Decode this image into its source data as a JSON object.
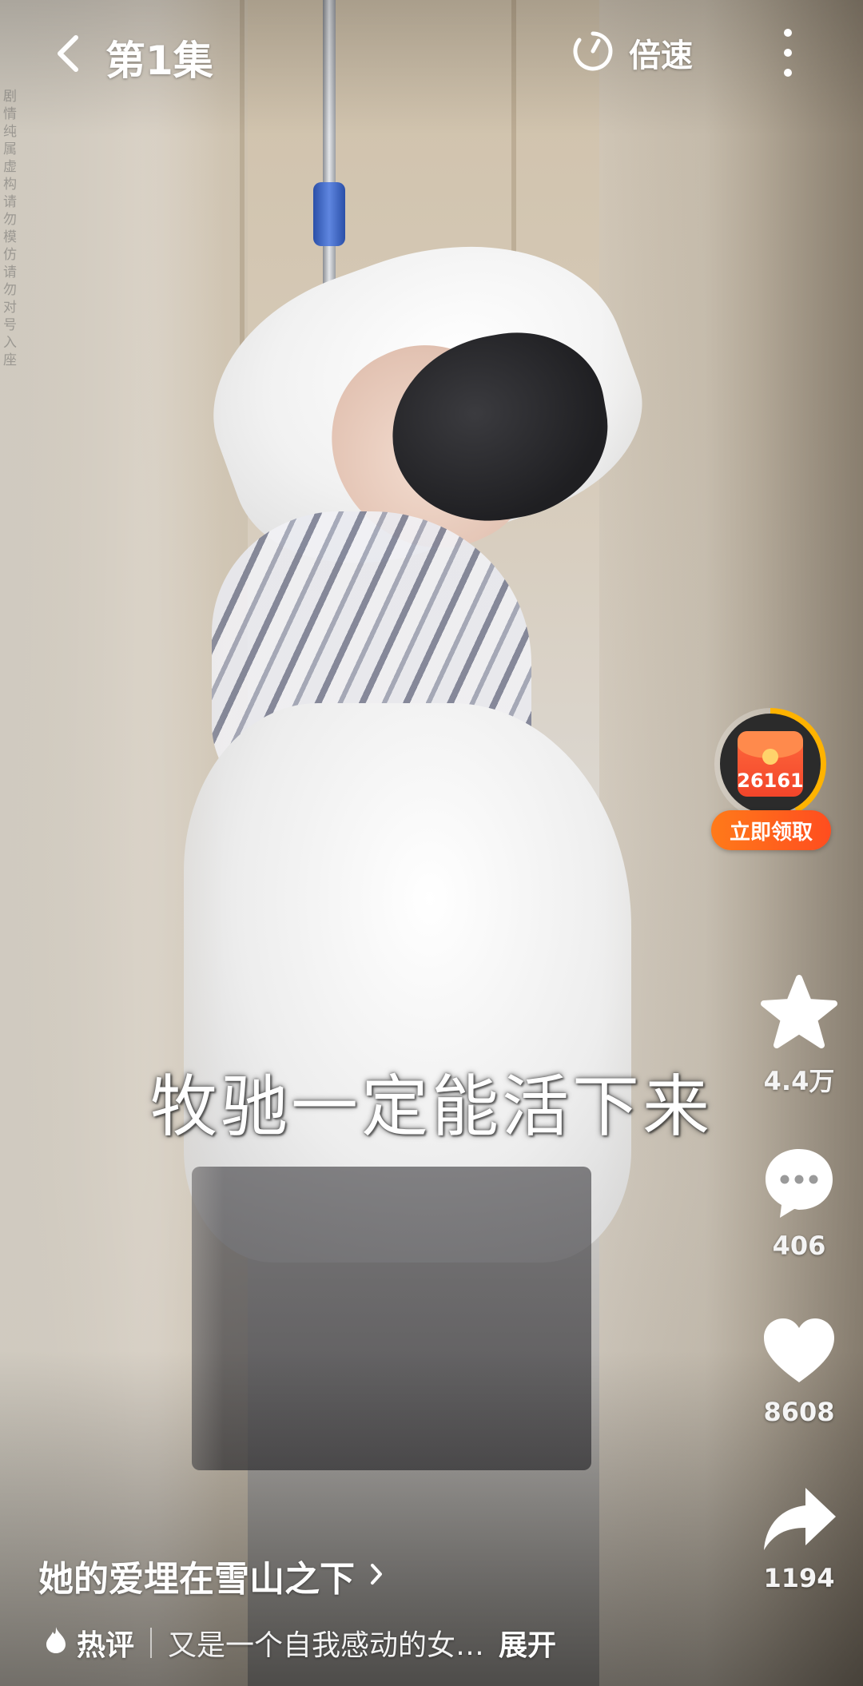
{
  "header": {
    "episode_title": "第1集",
    "speed_label": "倍速"
  },
  "video": {
    "subtitle": "牧驰一定能活下来",
    "watermark": "剧情纯属虚构请勿模仿请勿对号入座"
  },
  "reward": {
    "count": "26161",
    "claim_label": "立即领取",
    "progress": 0.42
  },
  "actions": {
    "favorite": {
      "icon": "star-icon",
      "count": "4.4万"
    },
    "comment": {
      "icon": "comment-icon",
      "count": "406"
    },
    "like": {
      "icon": "heart-icon",
      "count": "8608"
    },
    "share": {
      "icon": "share-icon",
      "count": "1194"
    }
  },
  "info": {
    "drama_title": "她的爱埋在雪山之下",
    "hot_label": "热评",
    "hot_comment": "又是一个自我感动的女…",
    "expand_label": "展开"
  },
  "colors": {
    "accent_orange": "#ff5a1f",
    "ring_progress": "#ffb300"
  }
}
